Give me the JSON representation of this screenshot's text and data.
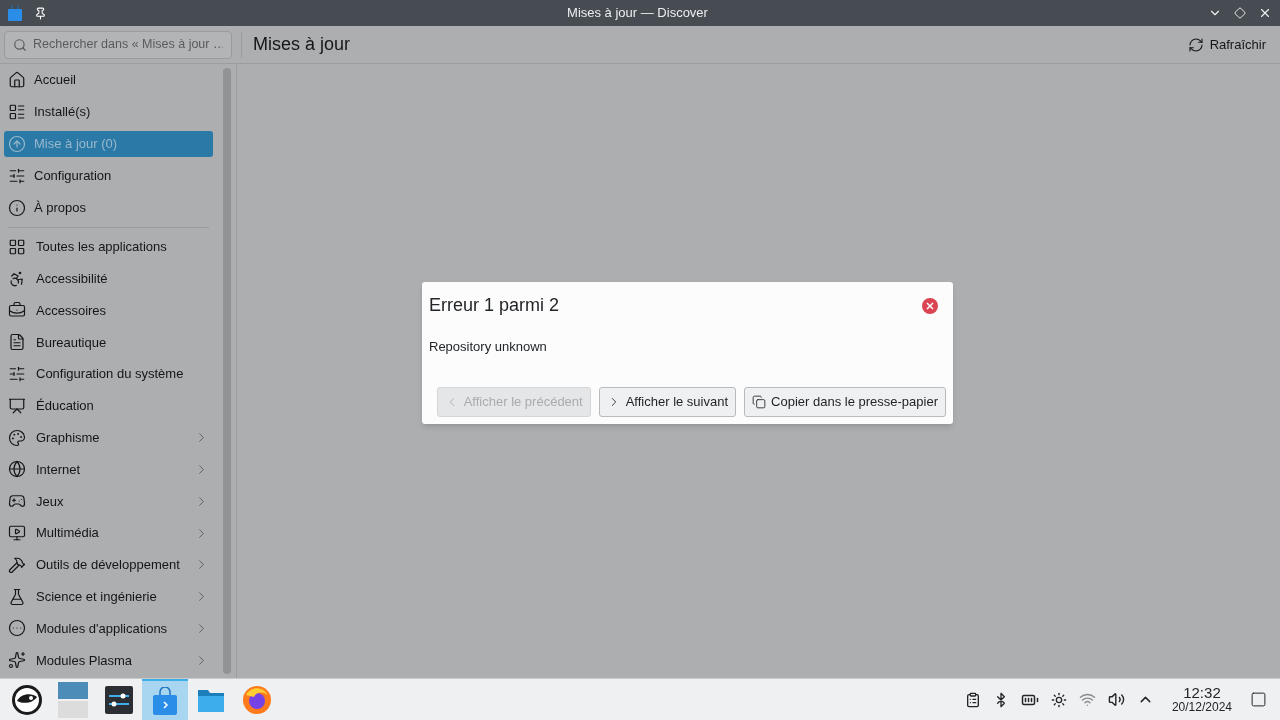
{
  "window": {
    "title": "Mises à jour — Discover"
  },
  "search": {
    "placeholder": "Rechercher dans « Mises à jour …"
  },
  "page": {
    "title": "Mises à jour",
    "refresh_button": "Rafraîchir"
  },
  "sidebar": {
    "main_items": [
      {
        "label": "Accueil",
        "kind": "home",
        "selected": false
      },
      {
        "label": "Installé(s)",
        "kind": "installed",
        "selected": false
      },
      {
        "label": "Mise à jour (0)",
        "kind": "update",
        "selected": true
      },
      {
        "label": "Configuration",
        "kind": "settings",
        "selected": false
      },
      {
        "label": "À propos",
        "kind": "info",
        "selected": false
      }
    ],
    "categories": [
      {
        "label": "Toutes les applications",
        "kind": "grid",
        "expandable": false
      },
      {
        "label": "Accessibilité",
        "kind": "accessibility",
        "expandable": false
      },
      {
        "label": "Accessoires",
        "kind": "toolbox",
        "expandable": false
      },
      {
        "label": "Bureautique",
        "kind": "office",
        "expandable": false
      },
      {
        "label": "Configuration du système",
        "kind": "settings",
        "expandable": false
      },
      {
        "label": "Éducation",
        "kind": "education",
        "expandable": false
      },
      {
        "label": "Graphisme",
        "kind": "graphics",
        "expandable": true
      },
      {
        "label": "Internet",
        "kind": "globe",
        "expandable": true
      },
      {
        "label": "Jeux",
        "kind": "games",
        "expandable": true
      },
      {
        "label": "Multimédia",
        "kind": "multimedia",
        "expandable": true
      },
      {
        "label": "Outils de développement",
        "kind": "hammer",
        "expandable": true
      },
      {
        "label": "Science et ingénierie",
        "kind": "flask",
        "expandable": true
      },
      {
        "label": "Modules d'applications",
        "kind": "dots",
        "expandable": true
      },
      {
        "label": "Modules Plasma",
        "kind": "plasma",
        "expandable": true
      }
    ]
  },
  "dialog": {
    "title": "Erreur 1 parmi 2",
    "message": "Repository unknown",
    "buttons": [
      {
        "label": "Afficher le précédent",
        "kind": "previous",
        "disabled": true
      },
      {
        "label": "Afficher le suivant",
        "kind": "next",
        "disabled": false
      },
      {
        "label": "Copier dans le presse-papier",
        "kind": "copy",
        "disabled": false
      }
    ]
  },
  "taskbar": {
    "apps": [
      {
        "kind": "distro",
        "selected": false
      },
      {
        "kind": "pager",
        "selected": false
      },
      {
        "kind": "sliders",
        "selected": false
      },
      {
        "kind": "store",
        "selected": true
      },
      {
        "kind": "folder",
        "selected": false
      },
      {
        "kind": "browser",
        "selected": false
      }
    ],
    "clock": {
      "time": "12:32",
      "date": "20/12/2024"
    }
  }
}
